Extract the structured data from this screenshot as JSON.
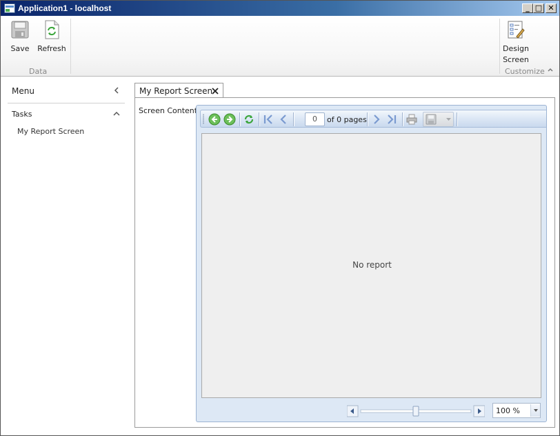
{
  "window": {
    "title": "Application1 - localhost",
    "min_label": "_",
    "max_label": "□",
    "close_label": "✕"
  },
  "ribbon": {
    "save_label": "Save",
    "refresh_label": "Refresh",
    "data_group_label": "Data",
    "design_label_line1": "Design",
    "design_label_line2": "Screen",
    "customize_group_label": "Customize"
  },
  "sidebar": {
    "menu_title": "Menu",
    "tasks_title": "Tasks",
    "items": [
      {
        "label": "My Report Screen"
      }
    ]
  },
  "tabs": [
    {
      "label": "My Report Screen"
    }
  ],
  "screen": {
    "content_label": "Screen Content:"
  },
  "report_viewer": {
    "page_number": "0",
    "page_of_text": "of 0 pages",
    "empty_message": "No report",
    "zoom_value": "100 %",
    "zoom_slider_fraction": 0.5
  },
  "colors": {
    "titlebar_start": "#0a246a",
    "titlebar_end": "#a6caf0",
    "nav_green": "#4caf50",
    "nav_blue": "#6f8fc9"
  }
}
